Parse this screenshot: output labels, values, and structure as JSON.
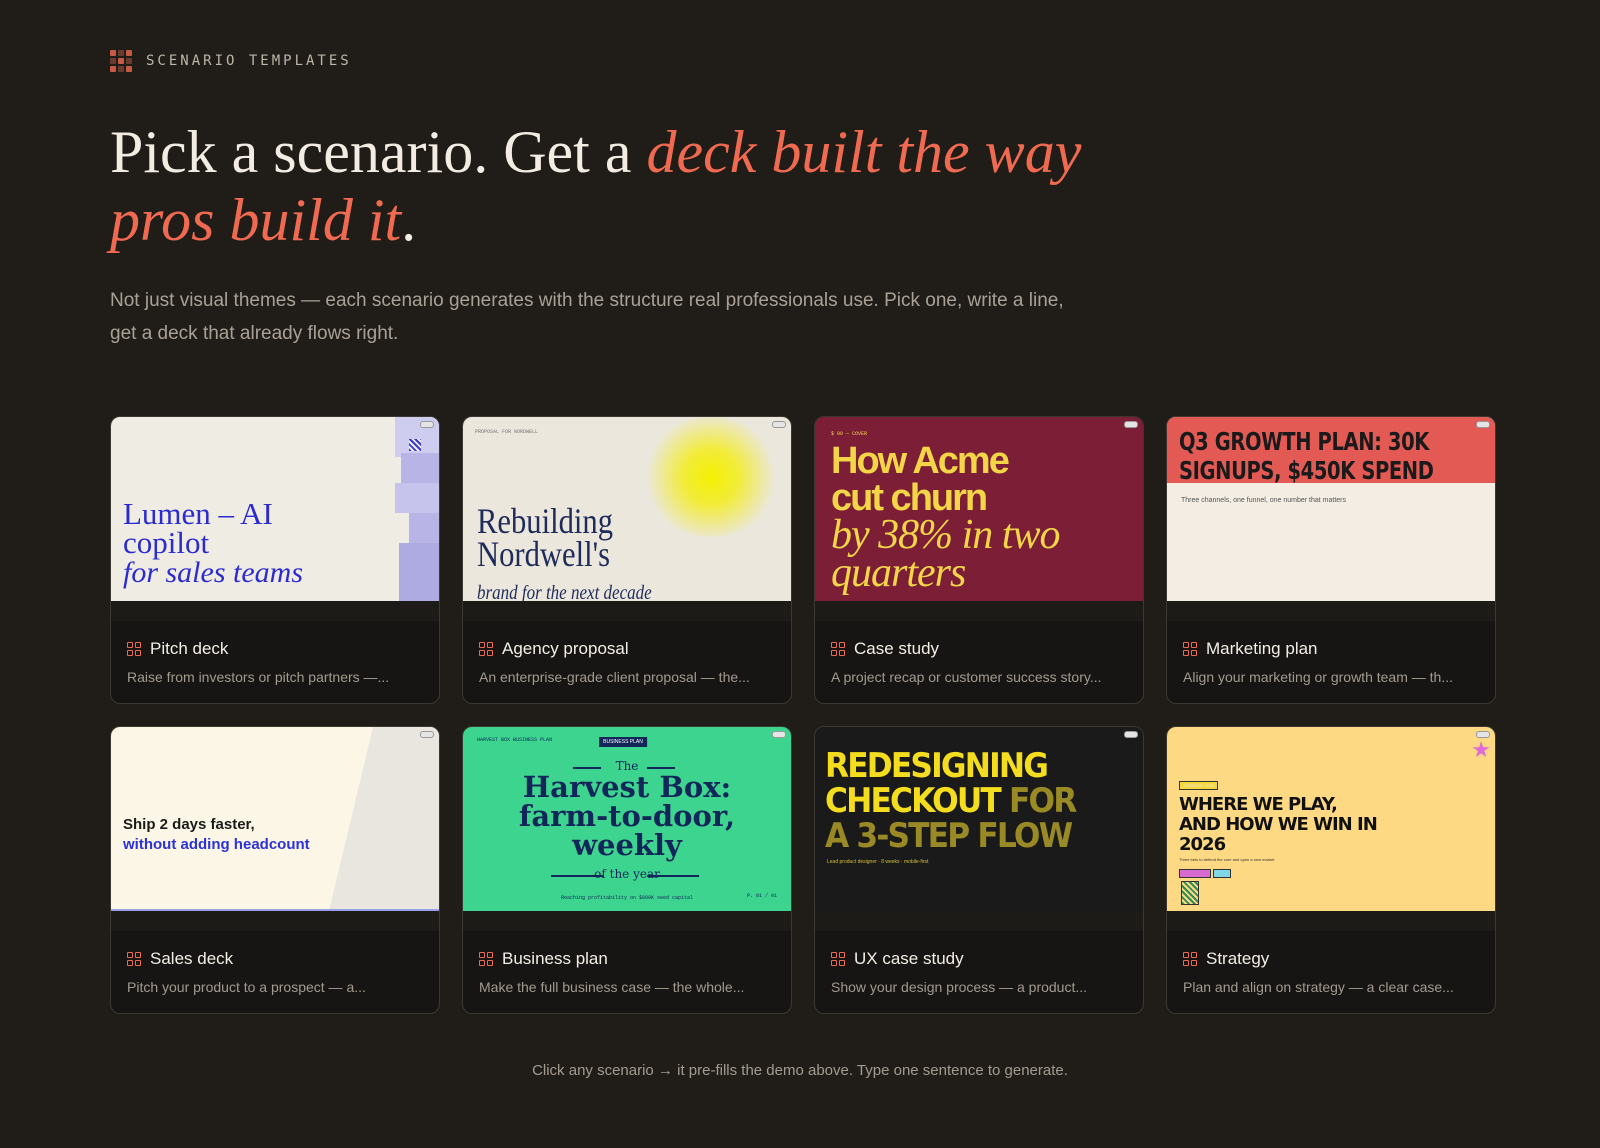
{
  "header": {
    "eyebrow": "SCENARIO TEMPLATES",
    "headline_plain": "Pick a scenario. Get a ",
    "headline_accent": "deck built the way pros build it",
    "headline_end": ".",
    "subtitle": "Not just visual themes — each scenario generates with the structure real professionals use. Pick one, write a line, get a deck that already flows right."
  },
  "colors": {
    "background": "#201d19",
    "accent": "#ef6a50"
  },
  "cards": [
    {
      "title": "Pitch deck",
      "description": "Raise from investors or pitch partners —...",
      "preview": {
        "line1": "Lumen – AI",
        "line2": "copilot",
        "line3": "for sales teams"
      }
    },
    {
      "title": "Agency proposal",
      "description": "An enterprise-grade client proposal — the...",
      "preview": {
        "eyebrow": "PROPOSAL FOR NORDWELL",
        "line1": "Rebuilding",
        "line2": "Nordwell's",
        "line3": "brand for the next decade"
      }
    },
    {
      "title": "Case study",
      "description": "A project recap or customer success story...",
      "preview": {
        "eyebrow": "$ 00 — COVER",
        "line1": "How Acme",
        "line2": "cut churn",
        "line3": "by 38% in two",
        "line4": "quarters"
      }
    },
    {
      "title": "Marketing plan",
      "description": "Align your marketing or growth team — th...",
      "preview": {
        "line1": "Q3 GROWTH PLAN: 30K",
        "line2": "SIGNUPS, $450K SPEND",
        "sub": "Three channels, one funnel, one number that matters"
      }
    },
    {
      "title": "Sales deck",
      "description": "Pitch your product to a prospect — a...",
      "preview": {
        "line1": "Ship 2 days faster,",
        "line2": "without adding headcount"
      }
    },
    {
      "title": "Business plan",
      "description": "Make the full business case — the whole...",
      "preview": {
        "eyebrow": "HARVEST BOX BUSINESS PLAN",
        "badge": "BUSINESS PLAN",
        "top": "The",
        "line1": "Harvest Box:",
        "line2": "farm-to-door,",
        "line3": "weekly",
        "bottom": "of the year",
        "sub": "Reaching profitability on $800K seed capital",
        "page": "P. 01 / 01"
      }
    },
    {
      "title": "UX case study",
      "description": "Show your design process — a product...",
      "preview": {
        "line1": "REDESIGNING",
        "line2a": "CHECKOUT ",
        "line2b": "FOR",
        "line3": "A 3-STEP FLOW",
        "sub": "Lead product designer · 8 weeks · mobile-first"
      }
    },
    {
      "title": "Strategy",
      "description": "Plan and align on strategy — a clear case...",
      "preview": {
        "tag": "STRATEGY 2026",
        "line1": "WHERE WE PLAY,",
        "line2": "AND HOW WE WIN IN",
        "line3": "2026",
        "sub": "Three bets to defend the core and open a new market"
      }
    }
  ],
  "footer": {
    "note": "Click any scenario → it pre-fills the demo above. Type one sentence to generate."
  }
}
